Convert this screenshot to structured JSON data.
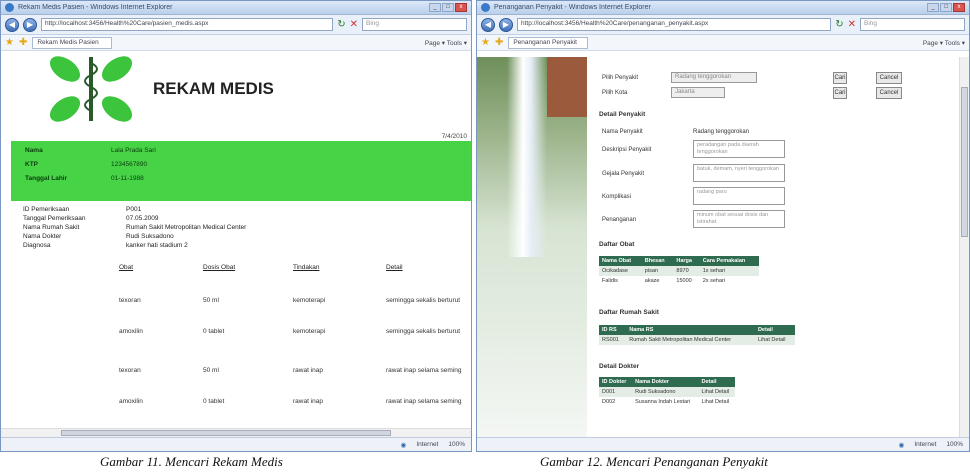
{
  "window1": {
    "title": "Rekam Medis Pasien - Windows Internet Explorer",
    "url": "http://localhost:3456/Health%20Care/pasien_medis.aspx",
    "search_placeholder": "Bing",
    "tab": "Rekam Medis Pasien",
    "tools": "Page ▾  Tools ▾",
    "header_title": "REKAM MEDIS",
    "date": "7/4/2010",
    "patient": [
      {
        "label": "Nama",
        "value": "Lala Prada Sari"
      },
      {
        "label": "KTP",
        "value": "1234567890"
      },
      {
        "label": "Tanggal Lahir",
        "value": "01-11-1988"
      }
    ],
    "exam": [
      {
        "label": "ID Pemeriksaan",
        "value": "P001"
      },
      {
        "label": "Tanggal Pemeriksaan",
        "value": "07.05.2009"
      },
      {
        "label": "Nama Rumah Sakit",
        "value": "Rumah Sakit Metropolitan Medical Center"
      },
      {
        "label": "Nama Dokter",
        "value": "Rudi Suksadono"
      },
      {
        "label": "Diagnosa",
        "value": "kanker hati stadium 2"
      }
    ],
    "table_headers": [
      "Obat",
      "Dosis Obat",
      "Tindakan",
      "Detail"
    ],
    "table_rows": [
      [
        "texoran",
        "50 ml",
        "kemoterapi",
        "semingga sekalis berturut"
      ],
      [
        "amoxilin",
        "0 tablet",
        "kemoterapi",
        "semingga sekalis berturut"
      ],
      [
        "texoran",
        "50 ml",
        "rawat inap",
        "rawat inap selama seming"
      ],
      [
        "amoxilin",
        "0 tablet",
        "rawat inap",
        "rawat inap selama seming"
      ]
    ],
    "status_zone": "Internet",
    "zoom": "100%"
  },
  "window2": {
    "title": "Penanganan Penyakit - Windows Internet Explorer",
    "url": "http://localhost:3456/Health%20Care/penanganan_penyakit.aspx",
    "search_placeholder": "Bing",
    "tab": "Penanganan Penyakit",
    "tools": "Page ▾  Tools ▾",
    "filters": [
      {
        "label": "Pilih Penyakit",
        "value": "Radang tenggorokan",
        "button": "Cari"
      },
      {
        "label": "Pilih Kota",
        "value": "Jakarta",
        "button": "Cari"
      }
    ],
    "cancel_label": "Cancel",
    "detail_title": "Detail Penyakit",
    "detail_fields": [
      {
        "label": "Nama Penyakit",
        "value": "Radang tenggorokan"
      },
      {
        "label": "Deskripsi Penyakit",
        "value": "peradangan pada daerah tenggorokan"
      },
      {
        "label": "Gejala Penyakit",
        "value": "batuk, demam, nyeri tenggorokan"
      },
      {
        "label": "Komplikasi",
        "value": "radang paru"
      },
      {
        "label": "Penanganan",
        "value": "minum obat sesuai dosis dan istirahat"
      }
    ],
    "obat_title": "Daftar Obat",
    "obat_headers": [
      "Nama Obat",
      "Bhesan",
      "Harga",
      "Cara Pemakaian"
    ],
    "obat_rows": [
      [
        "Ocikadase",
        "pisan",
        "8970",
        "1x sehari"
      ],
      [
        "Falidis",
        "akaze",
        "15000",
        "2x sehari"
      ]
    ],
    "rs_title": "Daftar Rumah Sakit",
    "rs_headers": [
      "ID RS",
      "Nama RS",
      "Detail"
    ],
    "rs_rows": [
      [
        "RS001",
        "Rumah Sakit Metropolitan Medical Center",
        "Lihat Detail"
      ]
    ],
    "dokter_title": "Detail Dokter",
    "dokter_headers": [
      "ID Dokter",
      "Nama Dokter",
      "Detail"
    ],
    "dokter_rows": [
      [
        "D001",
        "Rudi Suksadono",
        "Lihat Detail"
      ],
      [
        "D002",
        "Susanna Indah Lestari",
        "Lihat Detail"
      ]
    ],
    "status_zone": "Internet",
    "zoom": "100%"
  },
  "captions": {
    "left": "Gambar 11. Mencari Rekam Medis",
    "right": "Gambar 12. Mencari Penanganan Penyakit"
  }
}
